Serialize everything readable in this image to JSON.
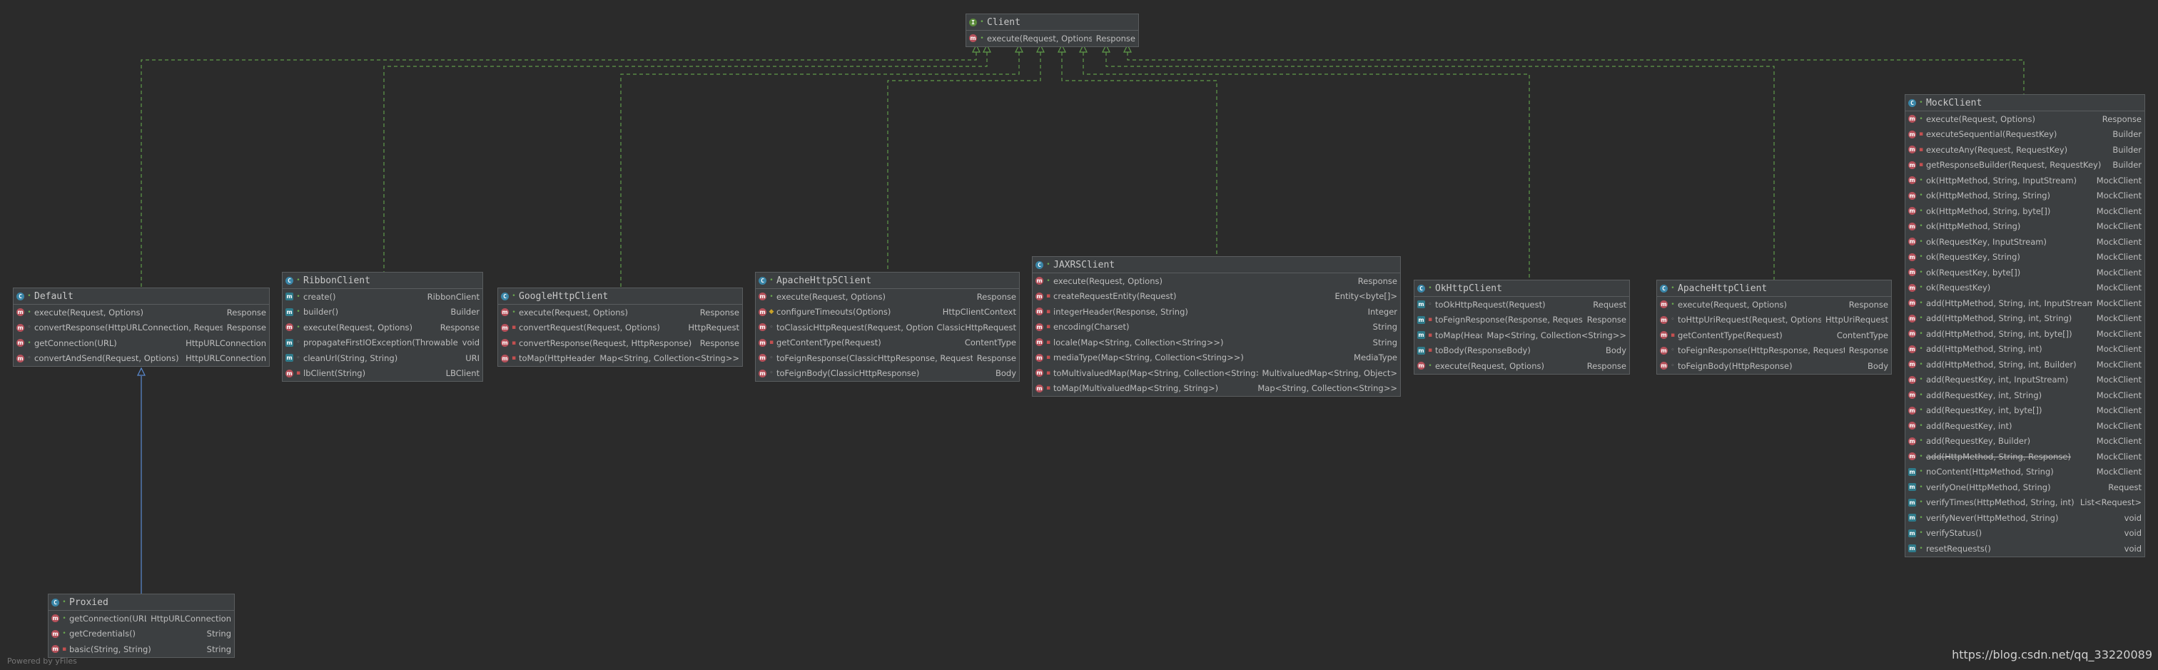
{
  "watermark": "https://blog.csdn.net/qq_33220089",
  "powered_by": "Powered by yFiles",
  "colors": {
    "background": "#2b2b2b",
    "node_fill": "#3c3f41",
    "edge_realization": "#5f9b4a",
    "edge_inheritance": "#5a8ad0"
  },
  "classes": [
    {
      "id": "client",
      "name": "Client",
      "kind": "interface",
      "members": [
        {
          "sig": "execute(Request, Options)",
          "ret": "Response",
          "vis": "pub",
          "icon": "m"
        }
      ]
    },
    {
      "id": "default",
      "name": "Default",
      "kind": "class",
      "members": [
        {
          "sig": "execute(Request, Options)",
          "ret": "Response",
          "vis": "pub",
          "icon": "m"
        },
        {
          "sig": "convertResponse(HttpURLConnection, Request)",
          "ret": "Response",
          "vis": "pkg",
          "icon": "m"
        },
        {
          "sig": "getConnection(URL)",
          "ret": "HttpURLConnection",
          "vis": "pub",
          "icon": "m"
        },
        {
          "sig": "convertAndSend(Request, Options)",
          "ret": "HttpURLConnection",
          "vis": "pkg",
          "icon": "m"
        }
      ]
    },
    {
      "id": "ribbon",
      "name": "RibbonClient",
      "kind": "class",
      "members": [
        {
          "sig": "create()",
          "ret": "RibbonClient",
          "vis": "pub",
          "icon": "mp"
        },
        {
          "sig": "builder()",
          "ret": "Builder",
          "vis": "pub",
          "icon": "mp"
        },
        {
          "sig": "execute(Request, Options)",
          "ret": "Response",
          "vis": "pub",
          "icon": "m"
        },
        {
          "sig": "propagateFirstIOException(Throwable)",
          "ret": "void",
          "vis": "pkg",
          "icon": "mp"
        },
        {
          "sig": "cleanUrl(String, String)",
          "ret": "URI",
          "vis": "pkg",
          "icon": "mp"
        },
        {
          "sig": "lbClient(String)",
          "ret": "LBClient",
          "vis": "priv",
          "icon": "m"
        }
      ]
    },
    {
      "id": "google",
      "name": "GoogleHttpClient",
      "kind": "class",
      "members": [
        {
          "sig": "execute(Request, Options)",
          "ret": "Response",
          "vis": "pub",
          "icon": "m"
        },
        {
          "sig": "convertRequest(Request, Options)",
          "ret": "HttpRequest",
          "vis": "priv",
          "icon": "m"
        },
        {
          "sig": "convertResponse(Request, HttpResponse)",
          "ret": "Response",
          "vis": "priv",
          "icon": "m"
        },
        {
          "sig": "toMap(HttpHeaders)",
          "ret": "Map<String, Collection<String>>",
          "vis": "priv",
          "icon": "m"
        }
      ]
    },
    {
      "id": "apachehttps",
      "name": "ApacheHttp5Client",
      "kind": "class",
      "members": [
        {
          "sig": "execute(Request, Options)",
          "ret": "Response",
          "vis": "pub",
          "icon": "m"
        },
        {
          "sig": "configureTimeouts(Options)",
          "ret": "HttpClientContext",
          "vis": "prot",
          "icon": "m"
        },
        {
          "sig": "toClassicHttpRequest(Request, Options)",
          "ret": "ClassicHttpRequest",
          "vis": "pkg",
          "icon": "m"
        },
        {
          "sig": "getContentType(Request)",
          "ret": "ContentType",
          "vis": "priv",
          "icon": "m"
        },
        {
          "sig": "toFeignResponse(ClassicHttpResponse, Request)",
          "ret": "Response",
          "vis": "pkg",
          "icon": "m"
        },
        {
          "sig": "toFeignBody(ClassicHttpResponse)",
          "ret": "Body",
          "vis": "pkg",
          "icon": "m"
        }
      ]
    },
    {
      "id": "jaxrs",
      "name": "JAXRSClient",
      "kind": "class",
      "members": [
        {
          "sig": "execute(Request, Options)",
          "ret": "Response",
          "vis": "pub",
          "icon": "m"
        },
        {
          "sig": "createRequestEntity(Request)",
          "ret": "Entity<byte[]>",
          "vis": "priv",
          "icon": "m"
        },
        {
          "sig": "integerHeader(Response, String)",
          "ret": "Integer",
          "vis": "priv",
          "icon": "m"
        },
        {
          "sig": "encoding(Charset)",
          "ret": "String",
          "vis": "priv",
          "icon": "m"
        },
        {
          "sig": "locale(Map<String, Collection<String>>)",
          "ret": "String",
          "vis": "priv",
          "icon": "m"
        },
        {
          "sig": "mediaType(Map<String, Collection<String>>)",
          "ret": "MediaType",
          "vis": "priv",
          "icon": "m"
        },
        {
          "sig": "toMultivaluedMap(Map<String, Collection<String>>)",
          "ret": "MultivaluedMap<String, Object>",
          "vis": "priv",
          "icon": "m"
        },
        {
          "sig": "toMap(MultivaluedMap<String, String>)",
          "ret": "Map<String, Collection<String>>",
          "vis": "priv",
          "icon": "m"
        }
      ]
    },
    {
      "id": "okhttp",
      "name": "OkHttpClient",
      "kind": "class",
      "members": [
        {
          "sig": "toOkHttpRequest(Request)",
          "ret": "Request",
          "vis": "pkg",
          "icon": "mp"
        },
        {
          "sig": "toFeignResponse(Response, Request)",
          "ret": "Response",
          "vis": "priv",
          "icon": "mp"
        },
        {
          "sig": "toMap(Headers)",
          "ret": "Map<String, Collection<String>>",
          "vis": "priv",
          "icon": "mp"
        },
        {
          "sig": "toBody(ResponseBody)",
          "ret": "Body",
          "vis": "priv",
          "icon": "mp"
        },
        {
          "sig": "execute(Request, Options)",
          "ret": "Response",
          "vis": "pub",
          "icon": "m"
        }
      ]
    },
    {
      "id": "apache",
      "name": "ApacheHttpClient",
      "kind": "class",
      "members": [
        {
          "sig": "execute(Request, Options)",
          "ret": "Response",
          "vis": "pub",
          "icon": "m"
        },
        {
          "sig": "toHttpUriRequest(Request, Options)",
          "ret": "HttpUriRequest",
          "vis": "pkg",
          "icon": "m"
        },
        {
          "sig": "getContentType(Request)",
          "ret": "ContentType",
          "vis": "priv",
          "icon": "m"
        },
        {
          "sig": "toFeignResponse(HttpResponse, Request)",
          "ret": "Response",
          "vis": "pkg",
          "icon": "m"
        },
        {
          "sig": "toFeignBody(HttpResponse)",
          "ret": "Body",
          "vis": "pkg",
          "icon": "m"
        }
      ]
    },
    {
      "id": "mock",
      "name": "MockClient",
      "kind": "class",
      "members": [
        {
          "sig": "execute(Request, Options)",
          "ret": "Response",
          "vis": "pub",
          "icon": "m"
        },
        {
          "sig": "executeSequential(RequestKey)",
          "ret": "Builder",
          "vis": "priv",
          "icon": "m"
        },
        {
          "sig": "executeAny(Request, RequestKey)",
          "ret": "Builder",
          "vis": "priv",
          "icon": "m"
        },
        {
          "sig": "getResponseBuilder(Request, RequestKey)",
          "ret": "Builder",
          "vis": "priv",
          "icon": "m"
        },
        {
          "sig": "ok(HttpMethod, String, InputStream)",
          "ret": "MockClient",
          "vis": "pub",
          "icon": "m"
        },
        {
          "sig": "ok(HttpMethod, String, String)",
          "ret": "MockClient",
          "vis": "pub",
          "icon": "m"
        },
        {
          "sig": "ok(HttpMethod, String, byte[])",
          "ret": "MockClient",
          "vis": "pub",
          "icon": "m"
        },
        {
          "sig": "ok(HttpMethod, String)",
          "ret": "MockClient",
          "vis": "pub",
          "icon": "m"
        },
        {
          "sig": "ok(RequestKey, InputStream)",
          "ret": "MockClient",
          "vis": "pub",
          "icon": "m"
        },
        {
          "sig": "ok(RequestKey, String)",
          "ret": "MockClient",
          "vis": "pub",
          "icon": "m"
        },
        {
          "sig": "ok(RequestKey, byte[])",
          "ret": "MockClient",
          "vis": "pub",
          "icon": "m"
        },
        {
          "sig": "ok(RequestKey)",
          "ret": "MockClient",
          "vis": "pub",
          "icon": "m"
        },
        {
          "sig": "add(HttpMethod, String, int, InputStream)",
          "ret": "MockClient",
          "vis": "pub",
          "icon": "m"
        },
        {
          "sig": "add(HttpMethod, String, int, String)",
          "ret": "MockClient",
          "vis": "pub",
          "icon": "m"
        },
        {
          "sig": "add(HttpMethod, String, int, byte[])",
          "ret": "MockClient",
          "vis": "pub",
          "icon": "m"
        },
        {
          "sig": "add(HttpMethod, String, int)",
          "ret": "MockClient",
          "vis": "pub",
          "icon": "m"
        },
        {
          "sig": "add(HttpMethod, String, int, Builder)",
          "ret": "MockClient",
          "vis": "pub",
          "icon": "m"
        },
        {
          "sig": "add(RequestKey, int, InputStream)",
          "ret": "MockClient",
          "vis": "pub",
          "icon": "m"
        },
        {
          "sig": "add(RequestKey, int, String)",
          "ret": "MockClient",
          "vis": "pub",
          "icon": "m"
        },
        {
          "sig": "add(RequestKey, int, byte[])",
          "ret": "MockClient",
          "vis": "pub",
          "icon": "m"
        },
        {
          "sig": "add(RequestKey, int)",
          "ret": "MockClient",
          "vis": "pub",
          "icon": "m"
        },
        {
          "sig": "add(RequestKey, Builder)",
          "ret": "MockClient",
          "vis": "pub",
          "icon": "m"
        },
        {
          "sig": "add(HttpMethod, String, Response)",
          "ret": "MockClient",
          "vis": "pub",
          "icon": "m",
          "strike": true
        },
        {
          "sig": "noContent(HttpMethod, String)",
          "ret": "MockClient",
          "vis": "pub",
          "icon": "mp"
        },
        {
          "sig": "verifyOne(HttpMethod, String)",
          "ret": "Request",
          "vis": "pub",
          "icon": "mp"
        },
        {
          "sig": "verifyTimes(HttpMethod, String, int)",
          "ret": "List<Request>",
          "vis": "pub",
          "icon": "mp"
        },
        {
          "sig": "verifyNever(HttpMethod, String)",
          "ret": "void",
          "vis": "pub",
          "icon": "mp"
        },
        {
          "sig": "verifyStatus()",
          "ret": "void",
          "vis": "pub",
          "icon": "mp"
        },
        {
          "sig": "resetRequests()",
          "ret": "void",
          "vis": "pub",
          "icon": "mp"
        }
      ]
    },
    {
      "id": "proxied",
      "name": "Proxied",
      "kind": "class",
      "members": [
        {
          "sig": "getConnection(URL)",
          "ret": "HttpURLConnection",
          "vis": "pub",
          "icon": "m"
        },
        {
          "sig": "getCredentials()",
          "ret": "String",
          "vis": "pub",
          "icon": "m"
        },
        {
          "sig": "basic(String, String)",
          "ret": "String",
          "vis": "priv",
          "icon": "m"
        }
      ]
    }
  ]
}
